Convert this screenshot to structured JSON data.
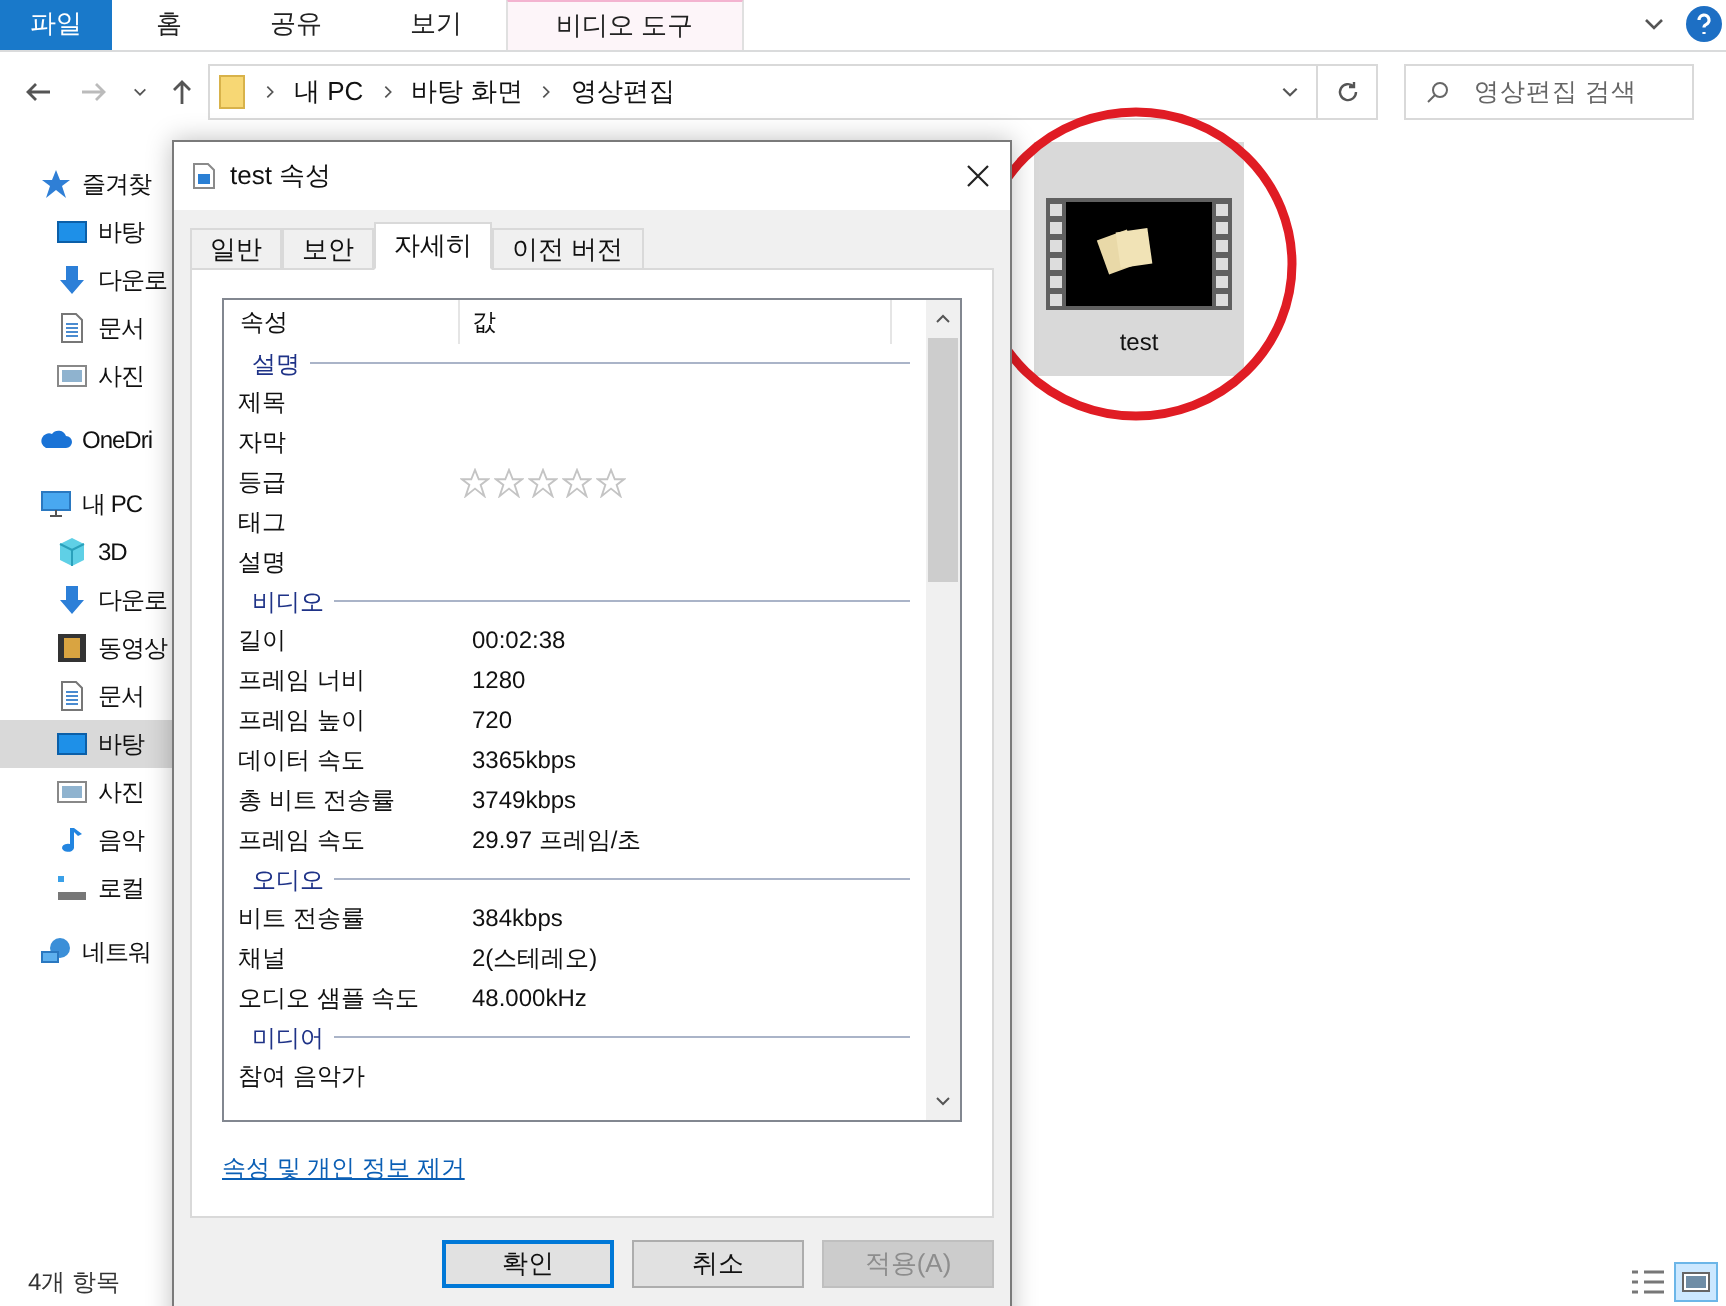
{
  "ribbon": {
    "tabs": [
      {
        "label": "파일",
        "selected": true,
        "kind": "file"
      },
      {
        "label": "홈",
        "selected": false,
        "kind": "plain"
      },
      {
        "label": "공유",
        "selected": false,
        "kind": "plain"
      },
      {
        "label": "보기",
        "selected": false,
        "kind": "plain"
      },
      {
        "label": "비디오 도구",
        "selected": false,
        "kind": "context"
      }
    ]
  },
  "address_bar": {
    "path": [
      "내 PC",
      "바탕 화면",
      "영상편집"
    ]
  },
  "search": {
    "placeholder": "영상편집 검색"
  },
  "sidebar": {
    "items": [
      {
        "label": "즐겨찾",
        "kind": "star",
        "selected": false,
        "children": [
          {
            "label": "바탕",
            "kind": "desktop",
            "selected": false
          },
          {
            "label": "다운로",
            "kind": "download",
            "selected": false
          },
          {
            "label": "문서",
            "kind": "document",
            "selected": false
          },
          {
            "label": "사진",
            "kind": "picture",
            "selected": false
          }
        ]
      },
      {
        "label": "OneDri",
        "kind": "cloud",
        "selected": false
      },
      {
        "label": "내 PC",
        "kind": "pc",
        "selected": false,
        "children": [
          {
            "label": "3D",
            "kind": "cube",
            "selected": false
          },
          {
            "label": "다운로",
            "kind": "download",
            "selected": false
          },
          {
            "label": "동영상",
            "kind": "film",
            "selected": false
          },
          {
            "label": "문서",
            "kind": "document",
            "selected": false
          },
          {
            "label": "바탕",
            "kind": "desktop",
            "selected": true
          },
          {
            "label": "사진",
            "kind": "picture",
            "selected": false
          },
          {
            "label": "음악",
            "kind": "music",
            "selected": false
          },
          {
            "label": "로컬",
            "kind": "drive",
            "selected": false
          }
        ]
      },
      {
        "label": "네트워",
        "kind": "network",
        "selected": false
      }
    ]
  },
  "files": [
    {
      "name": "test",
      "selected": true
    }
  ],
  "status_bar": {
    "count": "4개 항목"
  },
  "dialog": {
    "title": "test 속성",
    "tabs": [
      {
        "label": "일반",
        "selected": false
      },
      {
        "label": "보안",
        "selected": false
      },
      {
        "label": "자세히",
        "selected": true
      },
      {
        "label": "이전 버전",
        "selected": false
      }
    ],
    "columns": [
      "속성",
      "값"
    ],
    "groups": [
      {
        "title": "설명",
        "rows": [
          {
            "name": "제목"
          },
          {
            "name": "자막"
          },
          {
            "name": "등급",
            "stars": 0
          },
          {
            "name": "태그"
          },
          {
            "name": "설명"
          }
        ]
      },
      {
        "title": "비디오",
        "rows": [
          {
            "name": "길이",
            "value": "00:02:38"
          },
          {
            "name": "프레임 너비",
            "value": "1280"
          },
          {
            "name": "프레임 높이",
            "value": "720"
          },
          {
            "name": "데이터 속도",
            "value": "3365kbps"
          },
          {
            "name": "총 비트 전송률",
            "value": "3749kbps"
          },
          {
            "name": "프레임 속도",
            "value": "29.97 프레임/초"
          }
        ]
      },
      {
        "title": "오디오",
        "rows": [
          {
            "name": "비트 전송률",
            "value": "384kbps"
          },
          {
            "name": "채널",
            "value": "2(스테레오)"
          },
          {
            "name": "오디오 샘플 속도",
            "value": "48.000kHz"
          }
        ]
      },
      {
        "title": "미디어",
        "rows": [
          {
            "name": "참여 음악가"
          }
        ]
      }
    ],
    "link": "속성 및 개인 정보 제거",
    "buttons": [
      {
        "label": "확인",
        "default": true,
        "disabled": false
      },
      {
        "label": "취소",
        "default": false,
        "disabled": false
      },
      {
        "label": "적용(A)",
        "default": false,
        "disabled": true
      }
    ]
  }
}
